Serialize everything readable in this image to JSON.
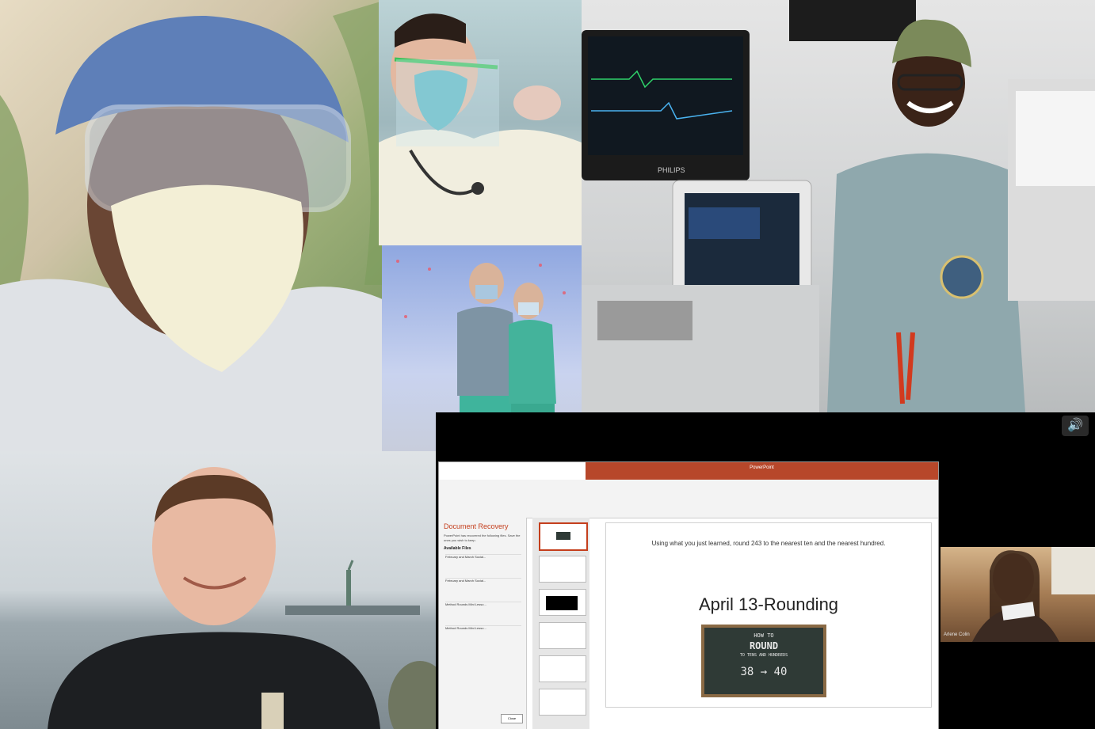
{
  "photos": [
    {
      "name": "selfie-goggles-mask",
      "subject": "health worker in surgical cap, goggles and mask"
    },
    {
      "name": "doctor-face-shield",
      "subject": "doctor with face shield, N95 and stethoscope"
    },
    {
      "name": "two-in-scrubs",
      "subject": "two health workers in scrubs and masks"
    },
    {
      "name": "anesthesia-room",
      "subject": "smiling clinician in scrubs beside anesthesia machine"
    },
    {
      "name": "man-harbor",
      "subject": "man in dark jacket at harbor with statue in background"
    }
  ],
  "monitor": {
    "brand": "PHILIPS"
  },
  "screen": {
    "app_title": "PowerPoint",
    "recovery_title": "Document Recovery",
    "recovery_intro": "PowerPoint has recovered the following files. Save the ones you wish to keep.",
    "available_files_label": "Available Files",
    "recovery_items": [
      "February and March Social...",
      "February and March Social...",
      "Method Rounds Mini Lesso...",
      "Method Rounds Mini Lesso..."
    ],
    "slide_question": "Using what you just learned, round 243 to the nearest ten and the nearest hundred.",
    "slide_heading": "April 13-Rounding",
    "board_line1": "HOW TO",
    "board_line2": "ROUND",
    "board_line3": "TO TENS AND HUNDREDS",
    "board_line4": "38 → 40",
    "close_label": "Close",
    "webcam_name": "Arlene Colin"
  }
}
